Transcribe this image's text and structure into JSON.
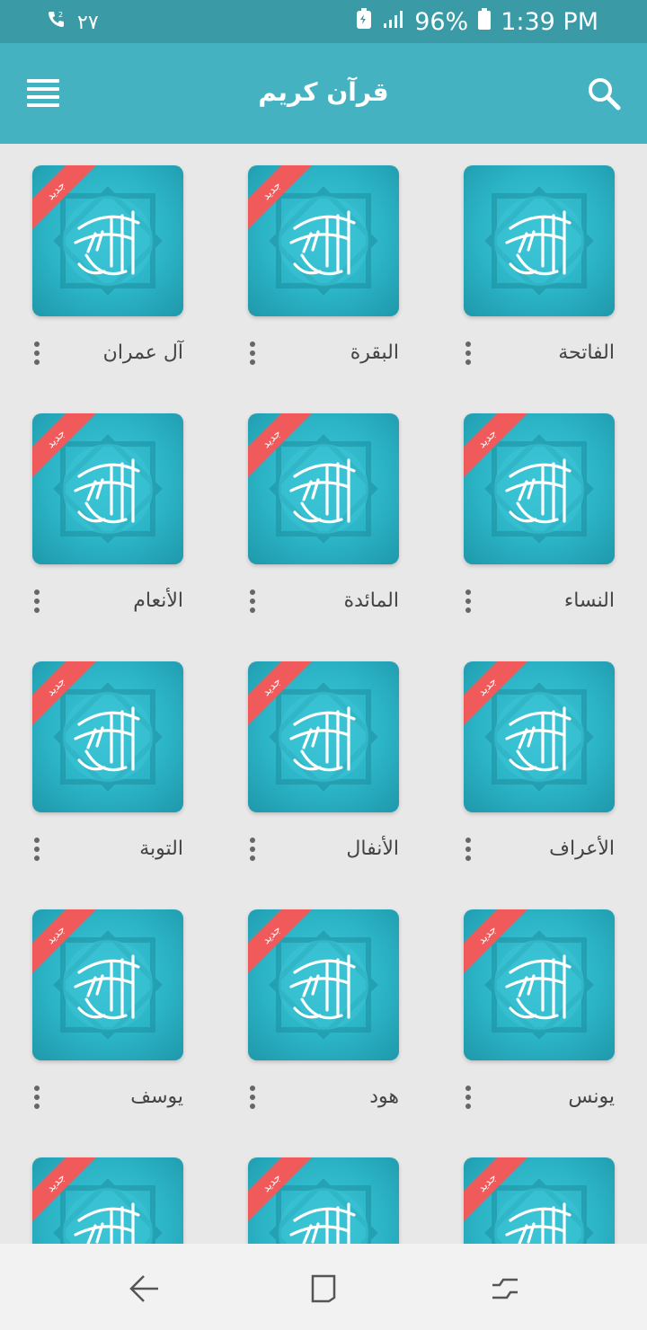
{
  "status_bar": {
    "time": "1:39 PM",
    "battery": "96%",
    "call_number": "٢٧",
    "icons": [
      "call-forward-icon",
      "battery-saver-icon",
      "signal-icon",
      "battery-icon"
    ]
  },
  "app_bar": {
    "title": "قرآن كريم",
    "icons": [
      "menu-icon",
      "search-icon"
    ]
  },
  "grid": {
    "new_badge": "جديد",
    "tiles": [
      {
        "label": "الفاتحة",
        "new": false
      },
      {
        "label": "البقرة",
        "new": true
      },
      {
        "label": "آل عمران",
        "new": true
      },
      {
        "label": "النساء",
        "new": true
      },
      {
        "label": "المائدة",
        "new": true
      },
      {
        "label": "الأنعام",
        "new": true
      },
      {
        "label": "الأعراف",
        "new": true
      },
      {
        "label": "الأنفال",
        "new": true
      },
      {
        "label": "التوبة",
        "new": true
      },
      {
        "label": "يونس",
        "new": true
      },
      {
        "label": "هود",
        "new": true
      },
      {
        "label": "يوسف",
        "new": true
      },
      {
        "label": "",
        "new": true
      },
      {
        "label": "",
        "new": true
      },
      {
        "label": "",
        "new": true
      }
    ]
  },
  "nav_bar": {
    "icons": [
      "back-icon",
      "home-icon",
      "recents-icon"
    ]
  },
  "colors": {
    "status_bar": "#3a9aa6",
    "app_bar": "#44b2c1",
    "tile": "#2bb3c6",
    "ribbon": "#f05a5a"
  }
}
